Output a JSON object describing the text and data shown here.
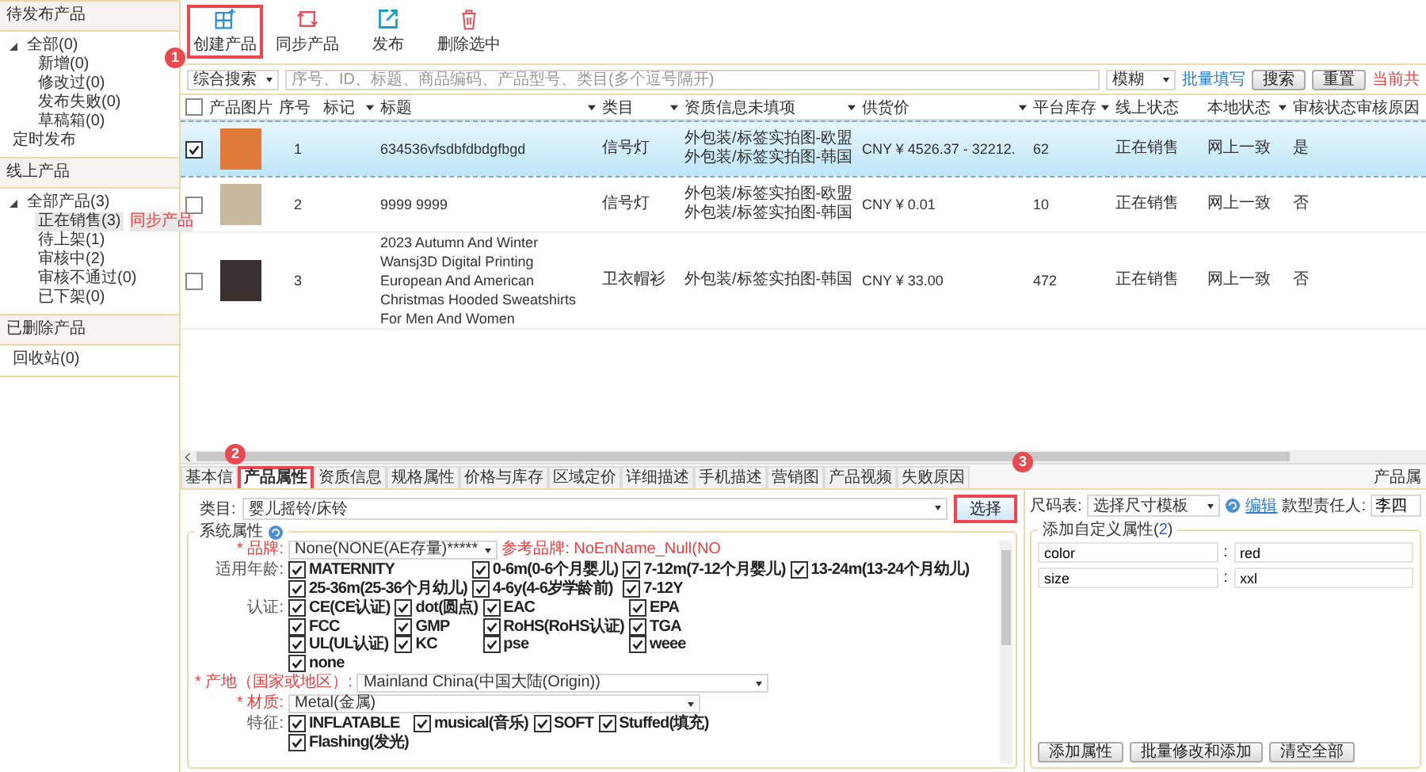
{
  "sidebar": {
    "sections": [
      {
        "title": "待发布产品",
        "items": [
          {
            "label": "全部(0)",
            "expanded": true,
            "selected": false,
            "children": [
              {
                "label": "新增(0)",
                "selected": false
              },
              {
                "label": "修改过(0)",
                "selected": false
              },
              {
                "label": "发布失败(0)",
                "selected": false
              },
              {
                "label": "草稿箱(0)",
                "selected": false
              }
            ]
          },
          {
            "label": "定时发布",
            "selected": false
          }
        ]
      },
      {
        "title": "线上产品",
        "items": [
          {
            "label": "全部产品(3)",
            "expanded": true,
            "selected": false,
            "children": [
              {
                "label": "正在销售(3)",
                "selected": true,
                "link": "同步产品"
              },
              {
                "label": "待上架(1)",
                "selected": false
              },
              {
                "label": "审核中(2)",
                "selected": false
              },
              {
                "label": "审核不通过(0)",
                "selected": false
              },
              {
                "label": "已下架(0)",
                "selected": false
              }
            ]
          }
        ]
      },
      {
        "title": "已删除产品",
        "items": [
          {
            "label": "回收站(0)",
            "selected": false
          }
        ]
      }
    ]
  },
  "toolbar": [
    {
      "kind": "create",
      "label": "创建产品",
      "highlighted": true,
      "badge": "1"
    },
    {
      "kind": "sync",
      "label": "同步产品",
      "highlighted": false
    },
    {
      "kind": "publish",
      "label": "发布",
      "highlighted": false
    },
    {
      "kind": "delete",
      "label": "删除选中",
      "highlighted": false
    }
  ],
  "search": {
    "mode": "综合搜索",
    "placeholder": "序号、ID、标题、商品编码、产品型号、类目(多个逗号隔开)",
    "match": "模糊",
    "batch_link": "批量填写",
    "buttons": [
      "搜索",
      "重置"
    ],
    "summary": "当前共"
  },
  "table": {
    "header_checked": false,
    "columns": [
      {
        "label": "产品图片",
        "filter": false
      },
      {
        "label": "序号",
        "filter": false
      },
      {
        "label": "标记",
        "filter": true
      },
      {
        "label": "标题",
        "filter": true
      },
      {
        "label": "类目",
        "filter": true
      },
      {
        "label": "资质信息未填项",
        "filter": true
      },
      {
        "label": "供货价",
        "filter": true
      },
      {
        "label": "平台库存",
        "filter": true
      },
      {
        "label": "线上状态",
        "filter": false
      },
      {
        "label": "本地状态",
        "filter": true
      },
      {
        "label": "审核状态",
        "filter": false
      },
      {
        "label": "审核原因",
        "filter": false
      }
    ],
    "rows": [
      {
        "checked": true,
        "selected": true,
        "index": "1",
        "title": "634536vfsdbfdbdgfbgd",
        "category": "信号灯",
        "missing": [
          "外包装/标签实拍图-欧盟",
          "外包装/标签实拍图-韩国"
        ],
        "price": "CNY ¥ 4526.37 - 32212.",
        "stock": "62",
        "online_status": "正在销售",
        "local_status": "网上一致",
        "review_status": "是"
      },
      {
        "checked": false,
        "selected": false,
        "index": "2",
        "title": "9999  9999",
        "category": "信号灯",
        "missing": [
          "外包装/标签实拍图-欧盟",
          "外包装/标签实拍图-韩国"
        ],
        "price": "CNY ¥ 0.01",
        "stock": "10",
        "online_status": "正在销售",
        "local_status": "网上一致",
        "review_status": "否"
      },
      {
        "checked": false,
        "selected": false,
        "index": "3",
        "title": "2023 Autumn And Winter Wansj3D Digital Printing European And American Christmas Hooded Sweatshirts For Men And Women",
        "category": "卫衣帽衫",
        "missing": [
          "外包装/标签实拍图-韩国"
        ],
        "price": "CNY ¥ 33.00",
        "stock": "472",
        "online_status": "正在销售",
        "local_status": "网上一致",
        "review_status": "否"
      }
    ]
  },
  "bottom": {
    "tabs": [
      {
        "label": "基本信",
        "selected": false,
        "highlighted": false
      },
      {
        "label": "产品属性",
        "selected": true,
        "highlighted": true,
        "badge": "2"
      },
      {
        "label": "资质信息",
        "selected": false,
        "highlighted": false
      },
      {
        "label": "规格属性",
        "selected": false,
        "highlighted": false
      },
      {
        "label": "价格与库存",
        "selected": false,
        "highlighted": false
      },
      {
        "label": "区域定价",
        "selected": false,
        "highlighted": false
      },
      {
        "label": "详细描述",
        "selected": false,
        "highlighted": false
      },
      {
        "label": "手机描述",
        "selected": false,
        "highlighted": false
      },
      {
        "label": "营销图",
        "selected": false,
        "highlighted": false
      },
      {
        "label": "产品视频",
        "selected": false,
        "highlighted": false
      },
      {
        "label": "失败原因",
        "selected": false,
        "highlighted": false
      }
    ],
    "panel_title": "产品属",
    "category": {
      "label": "类目:",
      "value": "婴儿摇铃/床铃"
    },
    "choose_button": {
      "label": "选择",
      "highlighted": true,
      "badge": "3"
    },
    "system_attributes": {
      "title": "系统属性",
      "rows": [
        {
          "kind": "select",
          "label": "* 品牌:",
          "required": true,
          "value": "None(NONE(AE存量)*****",
          "hint": "参考品牌: NoEnName_Null(NO"
        },
        {
          "kind": "checks",
          "label": "适用年龄:",
          "required": false,
          "options": [
            {
              "label": "MATERNITY",
              "checked": true
            },
            {
              "label": "0-6m(0-6个月婴儿)",
              "checked": true
            },
            {
              "label": "7-12m(7-12个月婴儿)",
              "checked": true
            },
            {
              "label": "13-24m(13-24个月幼儿)",
              "checked": true
            },
            {
              "label": "25-36m(25-36个月幼儿)",
              "checked": true
            },
            {
              "label": "4-6y(4-6岁学龄前)",
              "checked": true
            },
            {
              "label": "7-12Y",
              "checked": true
            }
          ]
        },
        {
          "kind": "checks",
          "label": "认证:",
          "required": false,
          "options": [
            {
              "label": "CE(CE认证)",
              "checked": true
            },
            {
              "label": "dot(圆点)",
              "checked": true
            },
            {
              "label": "EAC",
              "checked": true
            },
            {
              "label": "EPA",
              "checked": true
            },
            {
              "label": "FCC",
              "checked": true
            },
            {
              "label": "GMP",
              "checked": true
            },
            {
              "label": "RoHS(RoHS认证)",
              "checked": true
            },
            {
              "label": "TGA",
              "checked": true
            },
            {
              "label": "UL(UL认证)",
              "checked": true
            },
            {
              "label": "KC",
              "checked": true
            },
            {
              "label": "pse",
              "checked": true
            },
            {
              "label": "weee",
              "checked": true
            },
            {
              "label": "none",
              "checked": true
            }
          ]
        },
        {
          "kind": "select",
          "label": "* 产地（国家或地区）:",
          "required": true,
          "value": "Mainland China(中国大陆(Origin))"
        },
        {
          "kind": "select",
          "label": "* 材质:",
          "required": true,
          "value": "Metal(金属)"
        },
        {
          "kind": "checks",
          "label": "特征:",
          "required": false,
          "options": [
            {
              "label": "INFLATABLE",
              "checked": true
            },
            {
              "label": "musical(音乐)",
              "checked": true
            },
            {
              "label": "SOFT",
              "checked": true
            },
            {
              "label": "Stuffed(填充)",
              "checked": true
            },
            {
              "label": "Flashing(发光)",
              "checked": true
            }
          ]
        }
      ]
    },
    "size_chart": {
      "label": "尺码表:",
      "value": "选择尺寸模板",
      "edit_link": "编辑",
      "owner_label": "款型责任人:",
      "owner": "李四"
    },
    "custom_attributes": {
      "title_prefix": "添加自定义属性(",
      "count": "2",
      "title_suffix": ")",
      "rows": [
        {
          "key": "color",
          "separator": ":",
          "value": "red"
        },
        {
          "key": "size",
          "separator": ":",
          "value": "xxl"
        }
      ],
      "buttons": [
        "添加属性",
        "批量修改和添加",
        "清空全部"
      ]
    }
  }
}
